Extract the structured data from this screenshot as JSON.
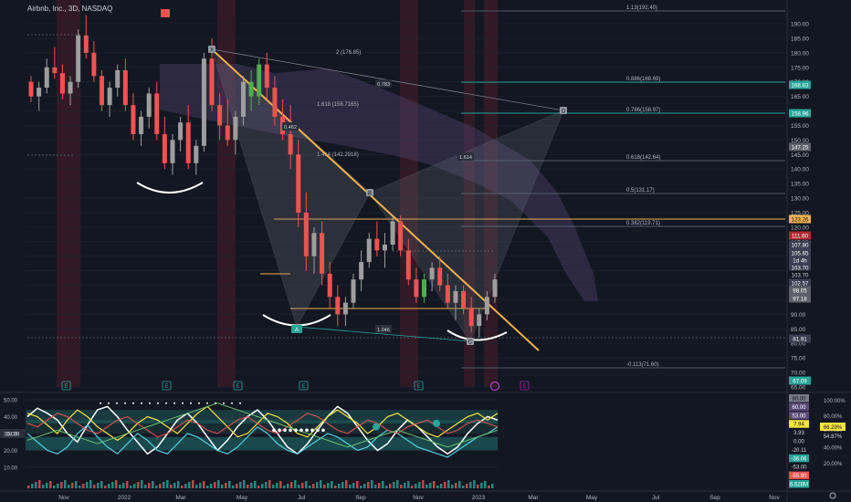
{
  "header": {
    "symbol_title": "Airbnb, Inc., 3D, NASDAQ"
  },
  "colors": {
    "background": "#131722",
    "up": "#9e9e9e",
    "up_green": "#26a69a",
    "down": "#ef5350",
    "fib_line": "#4f5a6b",
    "fib_green": "#26a69a",
    "harmonic_fill": "#787b86",
    "trendline": "#f0b04a",
    "cloud": "#5b4a7a",
    "dark_red_band": "#4a1e2a"
  },
  "price_axis": {
    "ticks": [
      "190.00",
      "185.00",
      "180.00",
      "175.00",
      "170.00",
      "165.00",
      "160.00",
      "155.00",
      "150.00",
      "145.00",
      "140.00",
      "135.00",
      "130.00",
      "125.00",
      "120.00",
      "115.00",
      "110.00",
      "105.00",
      "100.00",
      "95.00",
      "90.00",
      "85.00",
      "80.00",
      "75.00",
      "70.00",
      "65.00"
    ],
    "badges": [
      {
        "value": "168.83",
        "color": "#26a69a",
        "text_color": "#ffffff"
      },
      {
        "value": "158.96",
        "color": "#26a69a",
        "text_color": "#ffffff"
      },
      {
        "value": "147.25",
        "color": "#5d606b",
        "text_color": "#ffffff"
      },
      {
        "value": "123.26",
        "color": "#f0b04a",
        "text_color": "#131722"
      },
      {
        "value": "111.60",
        "color": "#b22833",
        "text_color": "#ffffff"
      },
      {
        "value": "107.80",
        "color": "#3a3f52",
        "text_color": "#ffffff"
      },
      {
        "value": "105.65",
        "color": "#3a3f52",
        "text_color": "#ffffff"
      },
      {
        "value": "1d 4h",
        "color": "#3a3f52",
        "text_color": "#ffffff"
      },
      {
        "value": "103.70",
        "color": "#3a3f52",
        "text_color": "#ffffff"
      },
      {
        "value": "103.70",
        "color": "#131722",
        "text_color": "#d1d4dc"
      },
      {
        "value": "102.57",
        "color": "#3a3f52",
        "text_color": "#ffffff"
      },
      {
        "value": "98.05",
        "color": "#5d606b",
        "text_color": "#ffffff"
      },
      {
        "value": "97.18",
        "color": "#5d606b",
        "text_color": "#ffffff"
      },
      {
        "value": "81.91",
        "color": "#3a3f52",
        "text_color": "#ffffff"
      },
      {
        "value": "67.09",
        "color": "#26a69a",
        "text_color": "#ffffff"
      }
    ]
  },
  "time_axis": {
    "labels": [
      "Nov",
      "2022",
      "Mar",
      "May",
      "Jul",
      "Sep",
      "Nov",
      "2023",
      "Mar",
      "May",
      "Jul",
      "Sep",
      "Nov"
    ]
  },
  "fib_labels": [
    {
      "text": "1.13(192.40)"
    },
    {
      "text": "2 (176.85)"
    },
    {
      "text": "0.886(168.69)"
    },
    {
      "text": "0.786(158.97)"
    },
    {
      "text": "1.618 (158.7165)"
    },
    {
      "text": "1.414 (142.2918)"
    },
    {
      "text": "0.618(142.64)"
    },
    {
      "text": "0.5(131.17)"
    },
    {
      "text": "0.382(119.71)"
    },
    {
      "text": "-0.113(71.60)"
    }
  ],
  "pattern_labels": {
    "x": "X",
    "b": "B",
    "d": "D",
    "c": "C",
    "a": "A"
  },
  "ratio_labels": [
    "0.783",
    "0.462",
    "1.614",
    "1.046"
  ],
  "earnings_marker": "E",
  "oscillator": {
    "axis_ticks": [
      "50.00",
      "40.00",
      "30.00",
      "20.00",
      "10.00"
    ],
    "right_ticks": [
      "100.00%",
      "80.00%",
      "60.00%",
      "40.00%",
      "20.00%"
    ],
    "badges": [
      {
        "value": "80.00",
        "color": "#787b86",
        "text_color": "#131722"
      },
      {
        "value": "60.00",
        "color": "#5b4a7a",
        "text_color": "#ffffff"
      },
      {
        "value": "53.00",
        "color": "#5b4a7a",
        "text_color": "#ffffff"
      },
      {
        "value": "7.94",
        "color": "#f7e33d",
        "text_color": "#131722"
      },
      {
        "value": "3.93",
        "color": "#131722",
        "text_color": "#d1d4dc"
      },
      {
        "value": "0.00",
        "color": "#131722",
        "text_color": "#d1d4dc"
      },
      {
        "value": "-20.11",
        "color": "#131722",
        "text_color": "#d1d4dc"
      },
      {
        "value": "-36.06",
        "color": "#26a69a",
        "text_color": "#ffffff"
      },
      {
        "value": "-53.00",
        "color": "#131722",
        "text_color": "#d1d4dc"
      },
      {
        "value": "-55.90",
        "color": "#ef5350",
        "text_color": "#ffffff"
      },
      {
        "value": "6.528M",
        "color": "#26a69a",
        "text_color": "#ffffff"
      }
    ],
    "percent_badges": [
      {
        "value": "66.29%",
        "color": "#f7e33d",
        "text_color": "#131722"
      },
      {
        "value": "54.87%",
        "color": "#131722",
        "text_color": "#d1d4dc"
      }
    ],
    "left_label": "38.09"
  },
  "chart_data": {
    "type": "candlestick",
    "title": "Airbnb, Inc., 3D, NASDAQ",
    "ylim": [
      65,
      195
    ],
    "candles": [
      [
        170,
        172,
        163,
        165
      ],
      [
        165,
        170,
        160,
        168
      ],
      [
        168,
        178,
        166,
        175
      ],
      [
        175,
        182,
        171,
        173
      ],
      [
        173,
        176,
        164,
        166
      ],
      [
        166,
        172,
        162,
        170
      ],
      [
        170,
        188,
        168,
        186
      ],
      [
        186,
        193,
        178,
        180
      ],
      [
        180,
        184,
        170,
        172
      ],
      [
        172,
        174,
        160,
        162
      ],
      [
        162,
        170,
        158,
        168
      ],
      [
        168,
        176,
        165,
        174
      ],
      [
        174,
        178,
        160,
        162
      ],
      [
        162,
        166,
        150,
        152
      ],
      [
        152,
        160,
        148,
        158
      ],
      [
        158,
        168,
        154,
        166
      ],
      [
        166,
        170,
        150,
        152
      ],
      [
        152,
        158,
        140,
        142
      ],
      [
        142,
        152,
        138,
        150
      ],
      [
        150,
        158,
        146,
        156
      ],
      [
        156,
        162,
        140,
        142
      ],
      [
        142,
        150,
        138,
        148
      ],
      [
        148,
        180,
        146,
        178
      ],
      [
        178,
        185,
        160,
        162
      ],
      [
        162,
        166,
        150,
        155
      ],
      [
        155,
        164,
        148,
        150
      ],
      [
        150,
        160,
        145,
        158
      ],
      [
        158,
        172,
        155,
        170
      ],
      [
        170,
        174,
        160,
        165
      ],
      [
        165,
        178,
        162,
        176
      ],
      [
        176,
        180,
        164,
        168
      ],
      [
        168,
        172,
        155,
        158
      ],
      [
        158,
        164,
        150,
        152
      ],
      [
        152,
        162,
        140,
        145
      ],
      [
        145,
        150,
        120,
        125
      ],
      [
        125,
        132,
        105,
        110
      ],
      [
        110,
        120,
        104,
        118
      ],
      [
        118,
        122,
        100,
        104
      ],
      [
        104,
        108,
        92,
        96
      ],
      [
        96,
        100,
        86,
        90
      ],
      [
        90,
        96,
        86,
        94
      ],
      [
        94,
        104,
        92,
        102
      ],
      [
        102,
        112,
        98,
        108
      ],
      [
        108,
        118,
        106,
        116
      ],
      [
        116,
        122,
        110,
        112
      ],
      [
        112,
        118,
        106,
        114
      ],
      [
        114,
        124,
        112,
        122
      ],
      [
        122,
        124,
        110,
        112
      ],
      [
        112,
        116,
        100,
        102
      ],
      [
        102,
        106,
        94,
        96
      ],
      [
        96,
        104,
        94,
        102
      ],
      [
        102,
        108,
        98,
        106
      ],
      [
        106,
        110,
        98,
        100
      ],
      [
        100,
        104,
        92,
        94
      ],
      [
        94,
        100,
        88,
        98
      ],
      [
        98,
        100,
        90,
        92
      ],
      [
        92,
        96,
        84,
        86
      ],
      [
        86,
        92,
        82,
        90
      ],
      [
        90,
        98,
        88,
        96
      ],
      [
        96,
        104,
        94,
        102
      ]
    ]
  }
}
